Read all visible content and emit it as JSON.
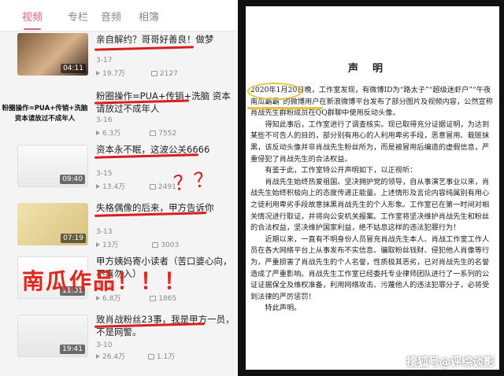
{
  "tabs": [
    {
      "label": "视频",
      "active": true
    },
    {
      "label": "专栏",
      "active": false
    },
    {
      "label": "音频",
      "active": false
    },
    {
      "label": "相簿",
      "active": false
    }
  ],
  "videos": [
    {
      "title": "亲自解约？哥哥好善良！做梦",
      "date": "3-17",
      "views": "19.7万",
      "danmaku": "2127",
      "duration": "04:11"
    },
    {
      "title": "粉圈操作=PUA+传销+洗脑 资本请放过不成年人",
      "date": "3-16",
      "views": "6.3万",
      "danmaku": "7552",
      "duration": "",
      "thumb_text": "粉圈操作=PUA+传销+洗脑 资本请放过不成年人"
    },
    {
      "title": "资本永不眠，这波公关6666",
      "date": "3-15",
      "views": "13.4万",
      "danmaku": "2491",
      "duration": "09:40"
    },
    {
      "title": "失格偶像的后来，甲方告诉你",
      "date": "3-13",
      "views": "13万",
      "danmaku": "3003",
      "duration": "07:19"
    },
    {
      "title": "甲方姨妈寄小读者（苦口婆心向，不喜勿入）",
      "date": "3-11",
      "views": "6.8万",
      "danmaku": "1865",
      "duration": "11:01"
    },
    {
      "title": "致肖战粉丝23事，我是甲方一员，不是网警。",
      "date": "3-10",
      "views": "26.4万",
      "danmaku": "1.1万",
      "duration": "19:41"
    }
  ],
  "overlay_label": "南瓜作品！！！",
  "scribble": "？？",
  "document": {
    "title": "声明",
    "paragraphs": [
      "2020年1月20日晚，工作室发现，有微博ID为“路太子”“超级迷虾户”“午夜南瓜霸霸”的微博用户在新浪微博平台发布了部分图片及视频内容，公然宣称肖战先生群粉成员在QQ群聊中使用反动头像。",
      "得知此事后，工作室进行了调查核实。现已取得充分证据证明，为达到某些不可告人的目的，部分别有用心的人利用卑劣手段，恶意冒用、栽赃抹黑，该反动头像并非肖战先生粉丝所为，而是被冒用后编造的虚假信息，严重侵犯了肖战先生的合法权益。",
      "有鉴于此，工作室特公开声明如下，以正视听：",
      "肖战先生始终热爱祖国、坚决拥护党的领导，自从事演艺事业以来，肖战先生始终积极向上的态度传递正能量。上述情形及言论内容纯属别有用心之徒利用卑劣手段故意抹黑肖战先生的个人形象。工作室已在第一时间对相关情况进行取证，并将向公安机关报案。工作室将坚决维护肖战先生和粉丝的合法权益，坚决维护国家利益，绝不姑息这样的违法犯罪行为！",
      "近期以来，一直有不明身份人员冒充肖战先生本人、肖战工作室工作人员在各大网络平台上从事发布不实信息、骗取粉丝钱财、侵犯他人肖像等行为，严重损害了肖战先生的个人名誉，性质极其恶劣，已对肖战先生的名誉造成了严重影响。肖战先生工作室已经委托专业律师团队进行了一系列的公证证据保全及维权准备，利用网络攻击、污蔑他人的违法犯罪分子，必将受到法律的严厉惩罚！",
      "特此声明。"
    ]
  },
  "watermark": "搜狐号@评综谈影",
  "colors": {
    "accent": "#e4607a",
    "marker_red": "#d81e1e",
    "highlight_yellow": "#e8c23a"
  }
}
